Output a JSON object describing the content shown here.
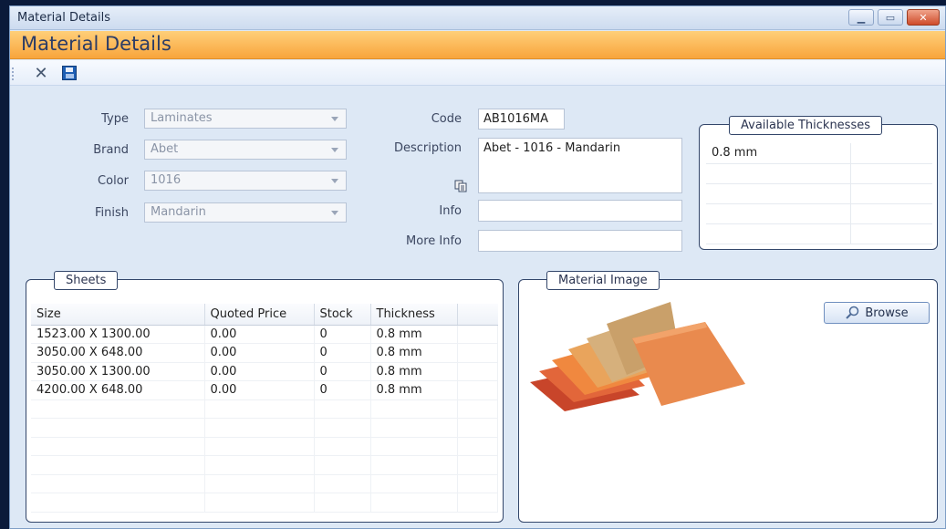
{
  "window": {
    "title": "Material Details"
  },
  "header": {
    "title": "Material Details"
  },
  "toolbar": {
    "close_glyph": "✕"
  },
  "form": {
    "type": {
      "label": "Type",
      "value": "Laminates"
    },
    "brand": {
      "label": "Brand",
      "value": "Abet"
    },
    "color": {
      "label": "Color",
      "value": "1016"
    },
    "finish": {
      "label": "Finish",
      "value": "Mandarin"
    },
    "code": {
      "label": "Code",
      "value": "AB1016MA"
    },
    "description": {
      "label": "Description",
      "value": "Abet - 1016 - Mandarin"
    },
    "info": {
      "label": "Info",
      "value": ""
    },
    "more_info": {
      "label": "More Info",
      "value": ""
    }
  },
  "thicknesses": {
    "title": "Available Thicknesses",
    "rows": [
      "0.8 mm",
      "",
      "",
      "",
      ""
    ]
  },
  "sheets": {
    "title": "Sheets",
    "columns": [
      "Size",
      "Quoted Price",
      "Stock",
      "Thickness"
    ],
    "rows": [
      [
        "1523.00 X 1300.00",
        "0.00",
        "0",
        "0.8 mm"
      ],
      [
        "3050.00 X 648.00",
        "0.00",
        "0",
        "0.8 mm"
      ],
      [
        "3050.00 X 1300.00",
        "0.00",
        "0",
        "0.8 mm"
      ],
      [
        "4200.00 X 648.00",
        "0.00",
        "0",
        "0.8 mm"
      ]
    ]
  },
  "image_panel": {
    "title": "Material Image",
    "browse_label": "Browse"
  }
}
